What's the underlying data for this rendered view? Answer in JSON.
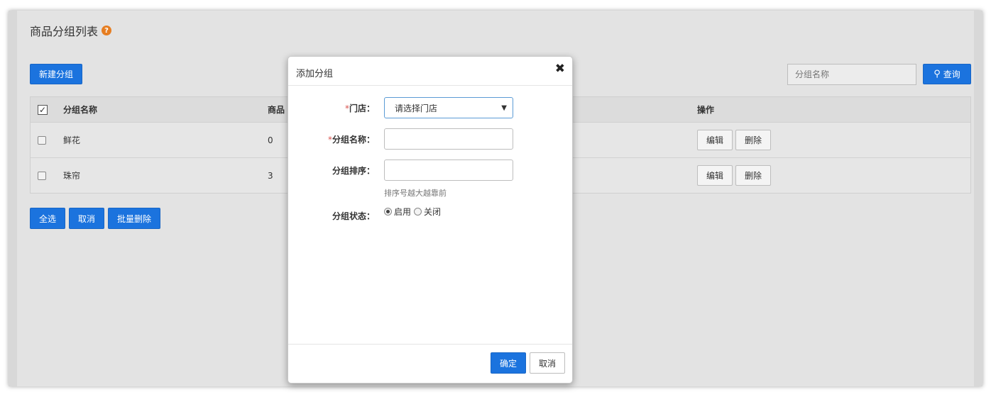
{
  "page": {
    "title": "商品分组列表",
    "help_icon": "?"
  },
  "toolbar": {
    "new_group_label": "新建分组",
    "search_placeholder": "分组名称",
    "search_icon": "search-icon",
    "search_label": "查询"
  },
  "table": {
    "columns": [
      "分组名称",
      "商品数",
      "操作"
    ],
    "visible_count_header": "商品",
    "rows": [
      {
        "name": "鲜花",
        "count": "0"
      },
      {
        "name": "珠帘",
        "count": "3"
      }
    ],
    "edit_label": "编辑",
    "delete_label": "删除"
  },
  "bulk_actions": {
    "select_all": "全选",
    "cancel": "取消",
    "batch_delete": "批量删除"
  },
  "modal": {
    "title": "添加分组",
    "close_icon": "✖",
    "required_mark": "*",
    "store_label": "门店：",
    "store_placeholder": "请选择门店",
    "name_label": "分组名称：",
    "sort_label": "分组排序：",
    "sort_help": "排序号越大越靠前",
    "status_label": "分组状态：",
    "status_options": [
      "启用",
      "关闭"
    ],
    "status_selected": "启用",
    "confirm_label": "确定",
    "cancel_label": "取消"
  },
  "colors": {
    "primary": "#1b73de",
    "help_icon": "#e67e22",
    "required": "#d9534f"
  }
}
